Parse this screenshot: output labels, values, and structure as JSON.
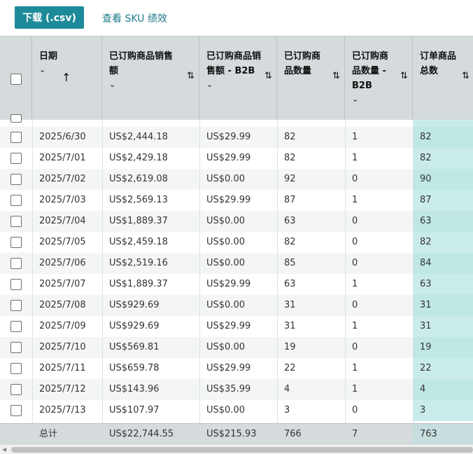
{
  "toolbar": {
    "download_label": "下载 (.csv)",
    "sku_link_label": "查看 SKU 绩效"
  },
  "columns": [
    {
      "label": "",
      "type": "checkbox"
    },
    {
      "label": "日期",
      "sort": "↑"
    },
    {
      "label": "已订购商品销售额",
      "sort": "⇅"
    },
    {
      "label": "已订购商品销售额 - B2B",
      "sort": "⇅"
    },
    {
      "label": "已订购商品数量",
      "sort": "⇅"
    },
    {
      "label": "已订购商品数量 - B2B",
      "sort": "⇅"
    },
    {
      "label": "订单商品总数",
      "sort": "⇅"
    }
  ],
  "rows": [
    [
      "2025/6/30",
      "US$2,444.18",
      "US$29.99",
      "82",
      "1",
      "82"
    ],
    [
      "2025/7/01",
      "US$2,429.18",
      "US$29.99",
      "82",
      "1",
      "82"
    ],
    [
      "2025/7/02",
      "US$2,619.08",
      "US$0.00",
      "92",
      "0",
      "90"
    ],
    [
      "2025/7/03",
      "US$2,569.13",
      "US$29.99",
      "87",
      "1",
      "87"
    ],
    [
      "2025/7/04",
      "US$1,889.37",
      "US$0.00",
      "63",
      "0",
      "63"
    ],
    [
      "2025/7/05",
      "US$2,459.18",
      "US$0.00",
      "82",
      "0",
      "82"
    ],
    [
      "2025/7/06",
      "US$2,519.16",
      "US$0.00",
      "85",
      "0",
      "84"
    ],
    [
      "2025/7/07",
      "US$1,889.37",
      "US$29.99",
      "63",
      "1",
      "63"
    ],
    [
      "2025/7/08",
      "US$929.69",
      "US$0.00",
      "31",
      "0",
      "31"
    ],
    [
      "2025/7/09",
      "US$929.69",
      "US$29.99",
      "31",
      "1",
      "31"
    ],
    [
      "2025/7/10",
      "US$569.81",
      "US$0.00",
      "19",
      "0",
      "19"
    ],
    [
      "2025/7/11",
      "US$659.78",
      "US$29.99",
      "22",
      "1",
      "22"
    ],
    [
      "2025/7/12",
      "US$143.96",
      "US$35.99",
      "4",
      "1",
      "4"
    ],
    [
      "2025/7/13",
      "US$107.97",
      "US$0.00",
      "3",
      "0",
      "3"
    ]
  ],
  "totals": {
    "label": "总计",
    "values": [
      "US$22,744.55",
      "US$215.93",
      "766",
      "7",
      "763"
    ]
  },
  "colors": {
    "accent": "#1d8a99",
    "link": "#1d7c8a",
    "header_bg": "#d5dbdc",
    "highlight": "#c9ecea"
  }
}
